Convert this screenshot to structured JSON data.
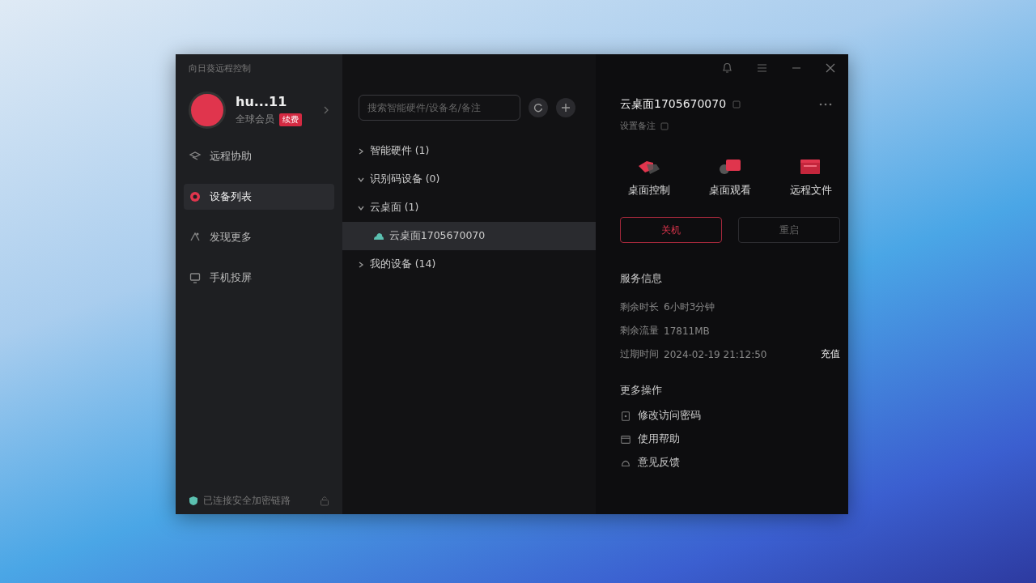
{
  "window": {
    "title": "向日葵远程控制"
  },
  "profile": {
    "name": "hu...11",
    "tier": "全球会员",
    "badge": "续费"
  },
  "nav": [
    {
      "label": "远程协助",
      "selected": false
    },
    {
      "label": "设备列表",
      "selected": true
    },
    {
      "label": "发现更多",
      "selected": false
    },
    {
      "label": "手机投屏",
      "selected": false
    }
  ],
  "status": "已连接安全加密链路",
  "search": {
    "placeholder": "搜索智能硬件/设备名/备注"
  },
  "tree": [
    {
      "label": "智能硬件 (1)",
      "expanded": false,
      "selected": false
    },
    {
      "label": "识别码设备 (0)",
      "expanded": true,
      "selected": false
    },
    {
      "label": "云桌面 (1)",
      "expanded": true,
      "selected": false,
      "children": [
        {
          "label": "云桌面1705670070",
          "selected": true
        }
      ]
    },
    {
      "label": "我的设备 (14)",
      "expanded": false,
      "selected": false
    }
  ],
  "device": {
    "name": "云桌面1705670070",
    "note_label": "设置备注"
  },
  "actions": [
    {
      "label": "桌面控制"
    },
    {
      "label": "桌面观看"
    },
    {
      "label": "远程文件"
    }
  ],
  "power_buttons": [
    {
      "label": "关机",
      "kind": "danger"
    },
    {
      "label": "重启",
      "kind": "normal"
    }
  ],
  "service": {
    "title": "服务信息",
    "rows": [
      {
        "label": "剩余时长",
        "value": "6小时3分钟"
      },
      {
        "label": "剩余流量",
        "value": "17811MB"
      },
      {
        "label": "过期时间",
        "value": "2024-02-19 21:12:50",
        "action": "充值"
      }
    ]
  },
  "more": {
    "title": "更多操作",
    "items": [
      {
        "label": "修改访问密码"
      },
      {
        "label": "使用帮助"
      },
      {
        "label": "意见反馈"
      }
    ]
  }
}
